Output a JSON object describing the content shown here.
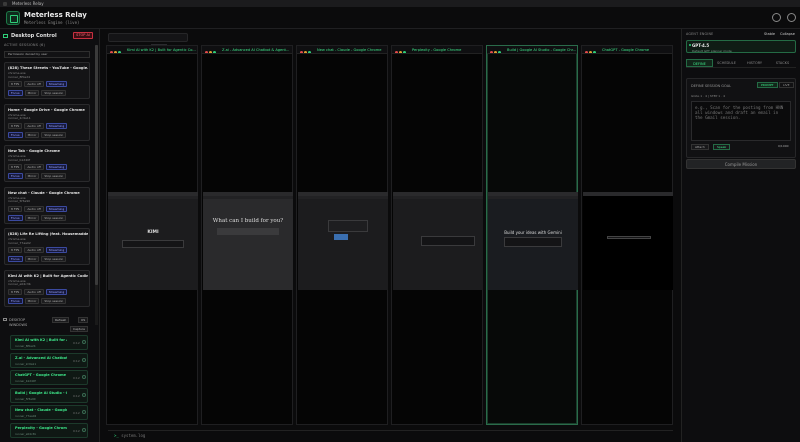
{
  "window": {
    "title": "Meterless Relay"
  },
  "header": {
    "title": "Meterless Relay",
    "subtitle": "Meterless Engine (live)"
  },
  "left": {
    "title": "Desktop Control",
    "stop": "STOP AI",
    "sessions_label": "ACTIVE SESSIONS (6)",
    "permission": "Permission denied by user",
    "sessions": [
      {
        "title": "(828) These Streets - YouTube - Google...",
        "sub1": "chrome.exe",
        "sub2": "runner_8f0e24",
        "fps": "FPS",
        "fps_val": "8",
        "audio": "Audio off",
        "status": "Streaming",
        "focus": "Focus",
        "mirror": "Mirror",
        "stop": "Stop session"
      },
      {
        "title": "Home - Google Drive - Google Chrome",
        "sub1": "chrome.exe",
        "sub2": "runner_2c9a11",
        "fps": "FPS",
        "fps_val": "8",
        "audio": "Audio off",
        "status": "Streaming",
        "focus": "Focus",
        "mirror": "Mirror",
        "stop": "Stop session"
      },
      {
        "title": "New Tab - Google Chrome",
        "sub1": "chrome.exe",
        "sub2": "runner_b1d40f",
        "fps": "FPS",
        "fps_val": "8",
        "audio": "Audio off",
        "status": "Streaming",
        "focus": "Focus",
        "mirror": "Mirror",
        "stop": "Stop session"
      },
      {
        "title": "New chat - Claude - Google Chrome",
        "sub1": "chrome.exe",
        "sub2": "runner_5f3e90",
        "fps": "FPS",
        "fps_val": "8",
        "audio": "Audio off",
        "status": "Streaming",
        "focus": "Focus",
        "mirror": "Mirror",
        "stop": "Stop session"
      },
      {
        "title": "(828) Life Re Lifting (feat. Housemaddest...",
        "sub1": "chrome.exe",
        "sub2": "runner_77aa02",
        "fps": "FPS",
        "fps_val": "8",
        "audio": "Audio off",
        "status": "Streaming",
        "focus": "Focus",
        "mirror": "Mirror",
        "stop": "Stop session"
      },
      {
        "title": "Kimi AI with K2 | Built for Agentic Codin...",
        "sub1": "chrome.exe",
        "sub2": "runner_e04c3b",
        "fps": "FPS",
        "fps_val": "8",
        "audio": "Audio off",
        "status": "Streaming",
        "focus": "Focus",
        "mirror": "Mirror",
        "stop": "Stop session"
      }
    ],
    "windows_label_1": "DESKTOP",
    "windows_label_2": "WINDOWS",
    "refresh": "Refresh",
    "count": "OS",
    "capture": "Capture",
    "windows": [
      {
        "title": "Kimi AI with K2 | Built for Age...",
        "sub": "runner_8f0e24",
        "n": "0:12"
      },
      {
        "title": "Z.ai - Advanced AI Chatbot &...",
        "sub": "runner_2c9a11",
        "n": "0:12"
      },
      {
        "title": "ChatGPT - Google Chrome",
        "sub": "runner_b1d40f",
        "n": "0:12"
      },
      {
        "title": "Build | Google AI Studio - Go...",
        "sub": "runner_5f3e90",
        "n": "0:12"
      },
      {
        "title": "New chat - Claude - Google C...",
        "sub": "runner_77aa02",
        "n": "0:12"
      },
      {
        "title": "Perplexity - Google Chrome",
        "sub": "runner_e04c3b",
        "n": "0:12"
      }
    ]
  },
  "center": {
    "tabs": [
      "2 cols",
      "Spread",
      "Grid",
      "Focus"
    ],
    "panels": [
      {
        "title": "Kimi AI with K2 | Built for Agentic Co...",
        "shot": "KIMI"
      },
      {
        "title": "Z.ai - Advanced AI Chatbot & Agent...",
        "shot": "What can I build for you?"
      },
      {
        "title": "New chat - Claude - Google Chrome",
        "shot": ""
      },
      {
        "title": "Perplexity - Google Chrome",
        "shot": ""
      },
      {
        "title": "Build | Google AI Studio - Google Chr...",
        "shot": "Build your ideas with Gemini"
      },
      {
        "title": "ChatGPT - Google Chrome",
        "shot": ""
      }
    ],
    "command": "system.log"
  },
  "right": {
    "label": "AGENT ENGINE",
    "state": "Stable",
    "collapse": "Collapse",
    "model": {
      "name": "GPT-4.5",
      "desc": "Default GPT planner mode"
    },
    "tabs": [
      "DEFINE",
      "SCHEDULE",
      "HISTORY",
      "STACKS"
    ],
    "goal_title": "DEFINE SESSION GOAL",
    "mode_prompt": "PROMPT",
    "mode_code": "LIVE",
    "segments": "GOAL 1 · 4 | STEP 1 · 4",
    "placeholder": "e.g., Scan for the posting from HNN all windows and draft an email in the Gmail session.",
    "btn1": "Attach",
    "btn2": "Speak",
    "count": "0/1000",
    "compile": "Compile Mission"
  }
}
